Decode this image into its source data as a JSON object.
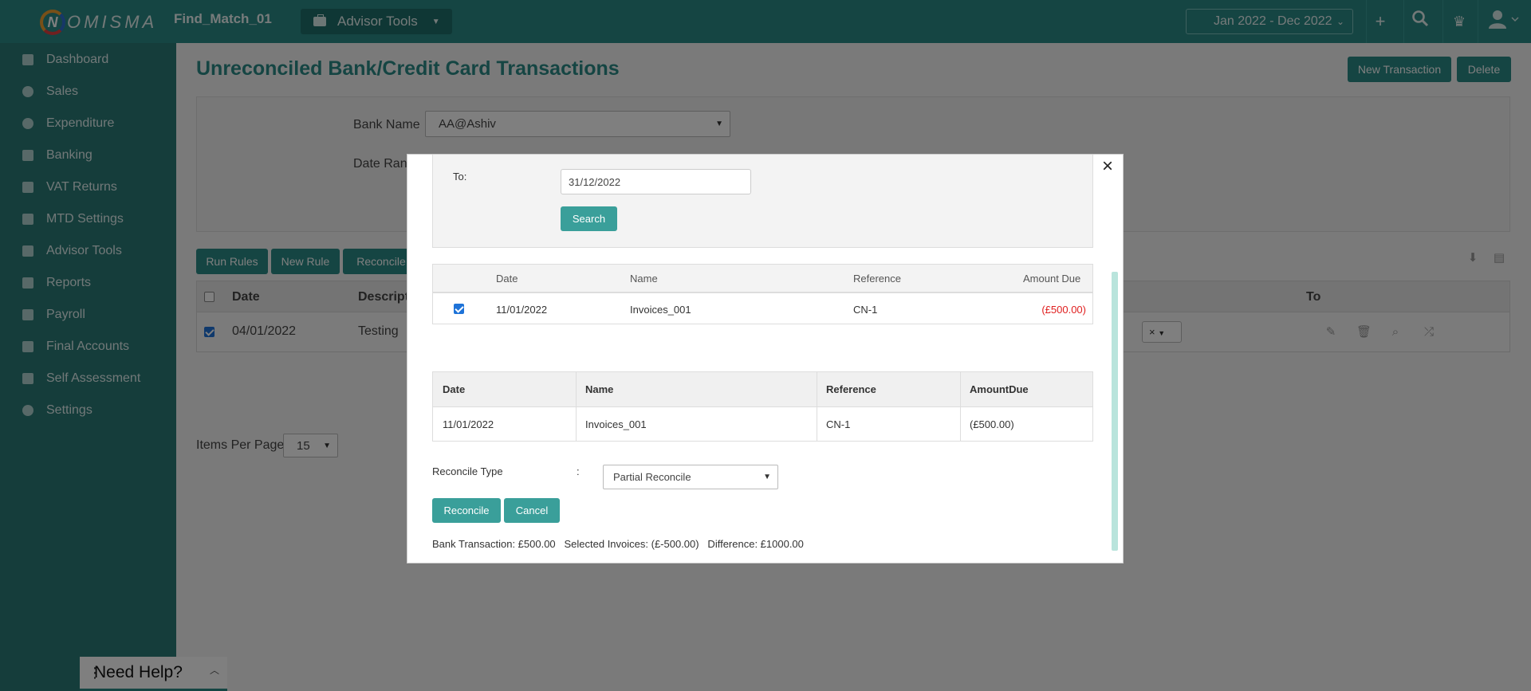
{
  "app": {
    "logo_n": "N",
    "logo_rest": "OMISMA",
    "title": "Find_Match_01"
  },
  "topbar": {
    "advisor_tools_label": "Advisor Tools",
    "date_range_value": "Jan 2022 - Dec 2022",
    "icons": [
      "plus-icon",
      "search-icon",
      "crest-icon",
      "user-icon"
    ]
  },
  "sidebar": {
    "items": [
      {
        "label": "Dashboard",
        "icon": "dashboard-icon"
      },
      {
        "label": "Sales",
        "icon": "sales-icon"
      },
      {
        "label": "Expenditure",
        "icon": "expenditure-icon"
      },
      {
        "label": "Banking",
        "icon": "bank-icon"
      },
      {
        "label": "VAT Returns",
        "icon": "vat-icon"
      },
      {
        "label": "MTD Settings",
        "icon": "mtd-icon"
      },
      {
        "label": "Advisor Tools",
        "icon": "briefcase-icon"
      },
      {
        "label": "Reports",
        "icon": "reports-icon"
      },
      {
        "label": "Payroll",
        "icon": "payroll-icon"
      },
      {
        "label": "Final Accounts",
        "icon": "accounts-icon"
      },
      {
        "label": "Self Assessment",
        "icon": "self-assessment-icon"
      },
      {
        "label": "Settings",
        "icon": "gear-icon"
      }
    ]
  },
  "main": {
    "page_title": "Unreconciled Bank/Credit Card Transactions",
    "new_transaction_label": "New Transaction",
    "delete_label": "Delete",
    "bank_name_label": "Bank Name",
    "bank_name_value": "AA@Ashiv",
    "date_range_label": "Date Range",
    "run_rules_label": "Run Rules",
    "new_rule_label": "New Rule",
    "reconcile_label": "Reconcile",
    "columns": {
      "date": "Date",
      "description": "Descripti",
      "to": "To"
    },
    "row": {
      "date": "04/01/2022",
      "description": "Testing",
      "tag_x": "×"
    },
    "items_per_page_label": "Items Per Page",
    "items_per_page_value": "15"
  },
  "modal": {
    "to_label": "To:",
    "to_value": "31/12/2022",
    "search_label": "Search",
    "results": {
      "headers": [
        "Date",
        "Name",
        "Reference",
        "Amount Due"
      ],
      "rows": [
        {
          "date": "11/01/2022",
          "name": "Invoices_001",
          "reference": "CN-1",
          "amount": "(£500.00)"
        }
      ]
    },
    "selected": {
      "headers": [
        "Date",
        "Name",
        "Reference",
        "AmountDue"
      ],
      "rows": [
        {
          "date": "11/01/2022",
          "name": "Invoices_001",
          "reference": "CN-1",
          "amount": "(£500.00)"
        }
      ]
    },
    "reconcile_type_label": "Reconcile Type",
    "reconcile_type_colon": ":",
    "reconcile_type_value": "Partial Reconcile",
    "reconcile_btn": "Reconcile",
    "cancel_btn": "Cancel",
    "summary": "Bank Transaction: £500.00   Selected Invoices: (£-500.00)   Difference: £1000.00",
    "negative_color": "#e02020"
  },
  "help": {
    "label": "Need Help?"
  }
}
